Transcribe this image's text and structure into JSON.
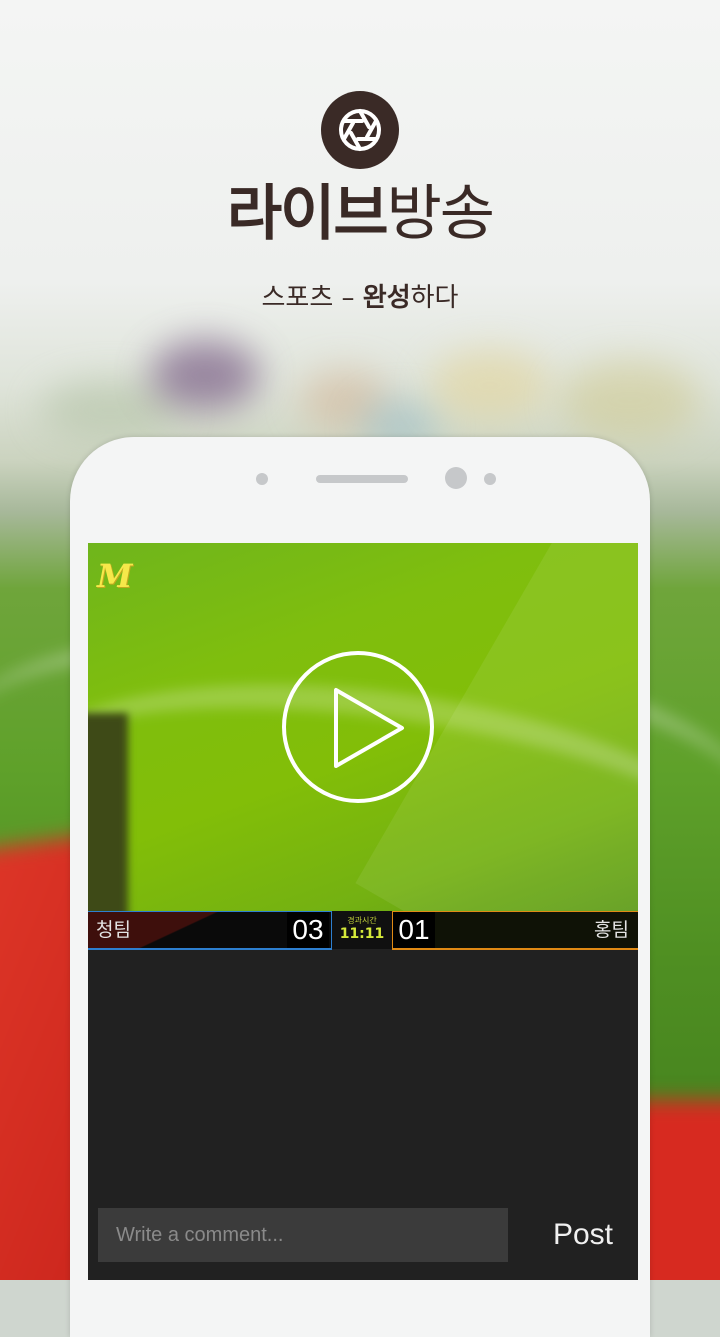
{
  "header": {
    "logo_icon": "camera-aperture-icon",
    "title_bold": "라이브",
    "title_light": "방송",
    "subtitle_pre": "스포츠 – ",
    "subtitle_bold": "완성",
    "subtitle_post": "하다"
  },
  "video": {
    "logo_text": "M",
    "play_icon": "play-circle-icon"
  },
  "scoreboard": {
    "left_team": "청팀",
    "left_score": "03",
    "timer_label": "경과시간",
    "timer_value": "11:11",
    "right_score": "01",
    "right_team": "홍팀",
    "left_color": "#2d7fd0",
    "right_color": "#e08a14"
  },
  "comment": {
    "placeholder": "Write a comment...",
    "post_label": "Post"
  },
  "colors": {
    "title": "#3a2a26",
    "screen_bg": "#212121",
    "timer": "#d4e83a"
  }
}
